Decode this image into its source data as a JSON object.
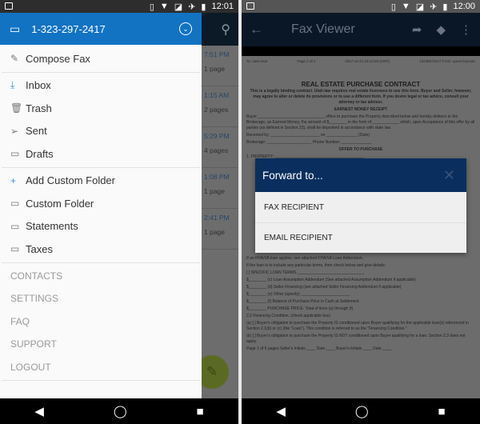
{
  "left": {
    "status": {
      "time": "12:01"
    },
    "background": {
      "rows": [
        {
          "time": "7:51 PM",
          "pages": "1 page"
        },
        {
          "time": "1:15 AM",
          "pages": "2 pages"
        },
        {
          "time": "5:29 PM",
          "pages": "4 pages"
        },
        {
          "time": "1:08 PM",
          "pages": "1 page"
        },
        {
          "time": "2:41 PM",
          "pages": "1 page"
        }
      ]
    },
    "drawer": {
      "account": "1-323-297-2417",
      "compose": "Compose Fax",
      "folders": [
        {
          "label": "Inbox",
          "icon": "inbox-icon"
        },
        {
          "label": "Trash",
          "icon": "trash-icon"
        },
        {
          "label": "Sent",
          "icon": "send-icon"
        },
        {
          "label": "Drafts",
          "icon": "folder-icon"
        }
      ],
      "custom": [
        {
          "label": "Add Custom Folder",
          "icon": "add-folder-icon"
        },
        {
          "label": "Custom Folder",
          "icon": "folder-icon"
        },
        {
          "label": "Statements",
          "icon": "folder-icon"
        },
        {
          "label": "Taxes",
          "icon": "folder-icon"
        }
      ],
      "links": [
        "CONTACTS",
        "SETTINGS",
        "FAQ",
        "SUPPORT",
        "LOGOUT"
      ],
      "accent": "#1273c3"
    }
  },
  "right": {
    "status": {
      "time": "12:00"
    },
    "toolbar": {
      "title": "Fax Viewer"
    },
    "document": {
      "to": "To: Jane Doe",
      "page": "Page 2 of 2",
      "date": "2017-12-21 19:13:35 (GMT)",
      "from": "13238972417 From: quest keynote",
      "title": "REAL ESTATE PURCHASE CONTRACT",
      "intro": "This is a legally binding contract. Utah law requires real estate licensees to use this form. Buyer and Seller, however, may agree to alter or delete its provisions or to use a different form. If you desire legal or tax advice, consult your attorney or tax advisor.",
      "receipt": "EARNEST MONEY RECEIPT",
      "buyer": "Buyer ______________________________ offers to purchase the Property described below and hereby delivers to the Brokerage, as Earnest Money, the amount of $________ in the form of ____________ which, upon Acceptance of this offer by all parties (as defined in Section 23), shall be deposited in accordance with state law.",
      "received": "Received by: ______________________ on ______________ (Date)",
      "brokerage": "Brokerage: ____________________ Phone Number ______________",
      "offer": "OFFER TO PURCHASE",
      "property": "1. PROPERTY: ________________________________________",
      "lower": [
        "If an FHA/VA loan applies, see attached FHA/VA Loan Addendum.",
        "If the loan is to include any particular terms, then check below and give details:",
        "[ ] SPECIFIC LOAN TERMS ______________________________",
        "$________ (c) Loan Assumption Addendum (See attached Assumption Addendum if applicable)",
        "$________ (d) Seller Financing (see attached Seller Financing Addendum if applicable)",
        "$________ (e) Other (specify) ______________________",
        "$________ (f) Balance of Purchase Price in Cash at Settlement",
        "$________ PURCHASE PRICE. Total of lines (a) through (f)",
        "2.2 Financing Condition. (check applicable box)",
        "(a) [ ] Buyer's obligation to purchase the Property IS conditioned upon Buyer qualifying for the applicable loan(s) referenced in Section 2.1(b) or (c) (the \"Loan\"). This condition is referred to as the \"Financing Condition.\"",
        "(b) [ ] Buyer's obligation to purchase the Property IS NOT conditioned upon Buyer qualifying for a loan. Section 2.3 does not apply.",
        "Page 1 of 6 pages   Seller's Initials ____ Date ____   Buyer's Initials ____ Date ____"
      ]
    },
    "dialog": {
      "title": "Forward to...",
      "options": [
        "FAX RECIPIENT",
        "EMAIL RECIPIENT"
      ],
      "accent": "#0a2f5e"
    }
  }
}
